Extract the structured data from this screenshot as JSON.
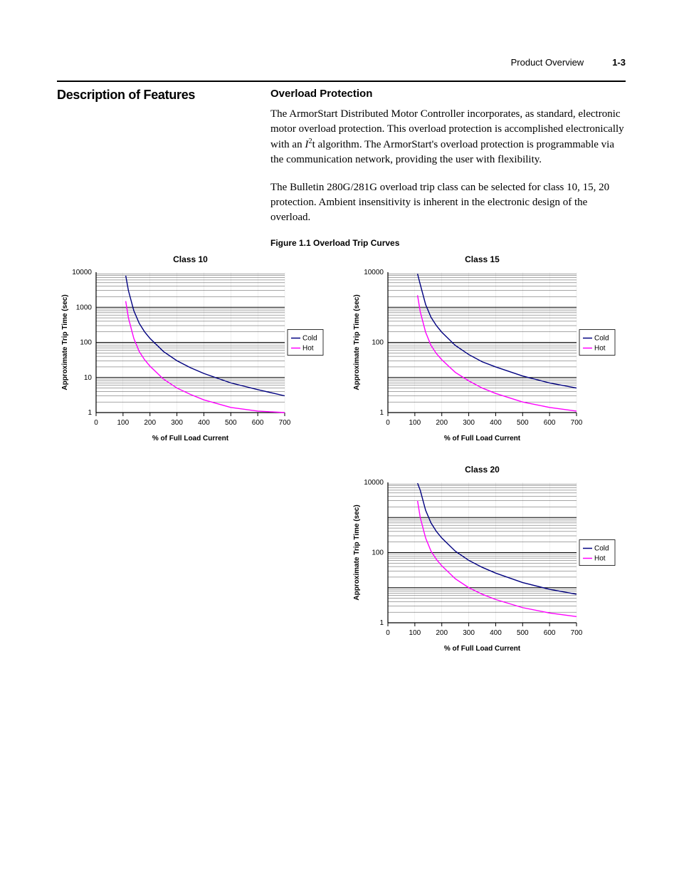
{
  "header": {
    "section": "Product Overview",
    "page_num": "1-3"
  },
  "left_heading": "Description of Features",
  "right_heading": "Overload Protection",
  "para1_a": "The ArmorStart Distributed Motor Controller incorporates, as standard, electronic motor overload protection. This overload protection is accomplished electronically with an ",
  "para1_i": "I",
  "para1_sup": "2",
  "para1_b": "t algorithm. The ArmorStart's overload protection is programmable via the communication network, providing the user with flexibility.",
  "para2": "The Bulletin 280G/281G overload trip class can be selected for class 10, 15, 20 protection. Ambient insensitivity is inherent in the electronic design of the overload.",
  "fig_caption": "Figure 1.1   Overload Trip Curves",
  "legend": {
    "cold": "Cold",
    "hot": "Hot"
  },
  "chart_data": [
    {
      "type": "line",
      "title": "Class 10",
      "xlabel": "% of Full Load Current",
      "ylabel": "Approximate Trip Time (sec)",
      "xlim": [
        0,
        700
      ],
      "ylim": [
        1,
        10000
      ],
      "yscale": "log",
      "x_ticks": [
        0,
        100,
        200,
        300,
        400,
        500,
        600,
        700
      ],
      "y_ticks": [
        1,
        10,
        100,
        1000,
        10000
      ],
      "series": [
        {
          "name": "Cold",
          "color": "#000080",
          "x": [
            110,
            120,
            140,
            160,
            180,
            200,
            250,
            300,
            350,
            400,
            500,
            600,
            700
          ],
          "y": [
            8000,
            3000,
            800,
            350,
            200,
            130,
            55,
            30,
            19,
            13,
            7,
            4.5,
            3
          ]
        },
        {
          "name": "Hot",
          "color": "#ff00ff",
          "x": [
            110,
            120,
            140,
            160,
            180,
            200,
            250,
            300,
            350,
            400,
            500,
            600,
            700
          ],
          "y": [
            1500,
            500,
            130,
            55,
            32,
            21,
            9,
            5,
            3.3,
            2.3,
            1.4,
            1.1,
            1
          ]
        }
      ]
    },
    {
      "type": "line",
      "title": "Class 15",
      "xlabel": "% of Full Load Current",
      "ylabel": "Approximate Trip Time (sec)",
      "xlim": [
        0,
        700
      ],
      "ylim": [
        1,
        10000
      ],
      "yscale": "log",
      "x_ticks": [
        0,
        100,
        200,
        300,
        400,
        500,
        600,
        700
      ],
      "y_ticks": [
        1,
        100,
        10000
      ],
      "series": [
        {
          "name": "Cold",
          "color": "#000080",
          "x": [
            110,
            120,
            140,
            160,
            180,
            200,
            250,
            300,
            350,
            400,
            500,
            600,
            700
          ],
          "y": [
            9000,
            4500,
            1200,
            520,
            300,
            195,
            82,
            45,
            28,
            20,
            11,
            7,
            5
          ]
        },
        {
          "name": "Hot",
          "color": "#ff00ff",
          "x": [
            110,
            120,
            140,
            160,
            180,
            200,
            250,
            300,
            350,
            400,
            500,
            600,
            700
          ],
          "y": [
            2200,
            750,
            195,
            82,
            48,
            32,
            14,
            8,
            5,
            3.5,
            2,
            1.4,
            1.1
          ]
        }
      ]
    },
    {
      "type": "line",
      "title": "Class 20",
      "xlabel": "% of Full Load Current",
      "ylabel": "Approximate Trip Time (sec)",
      "xlim": [
        0,
        700
      ],
      "ylim": [
        1,
        10000
      ],
      "yscale": "log",
      "x_ticks": [
        0,
        100,
        200,
        300,
        400,
        500,
        600,
        700
      ],
      "y_ticks": [
        1,
        100,
        10000
      ],
      "series": [
        {
          "name": "Cold",
          "color": "#000080",
          "x": [
            110,
            120,
            140,
            160,
            180,
            200,
            250,
            300,
            350,
            400,
            500,
            600,
            700
          ],
          "y": [
            9500,
            6000,
            1600,
            700,
            400,
            260,
            110,
            60,
            38,
            26,
            14,
            9,
            6.5
          ]
        },
        {
          "name": "Hot",
          "color": "#ff00ff",
          "x": [
            110,
            120,
            140,
            160,
            180,
            200,
            250,
            300,
            350,
            400,
            500,
            600,
            700
          ],
          "y": [
            3000,
            1000,
            260,
            110,
            64,
            42,
            18,
            10,
            6.5,
            4.6,
            2.7,
            1.9,
            1.5
          ]
        }
      ]
    }
  ]
}
